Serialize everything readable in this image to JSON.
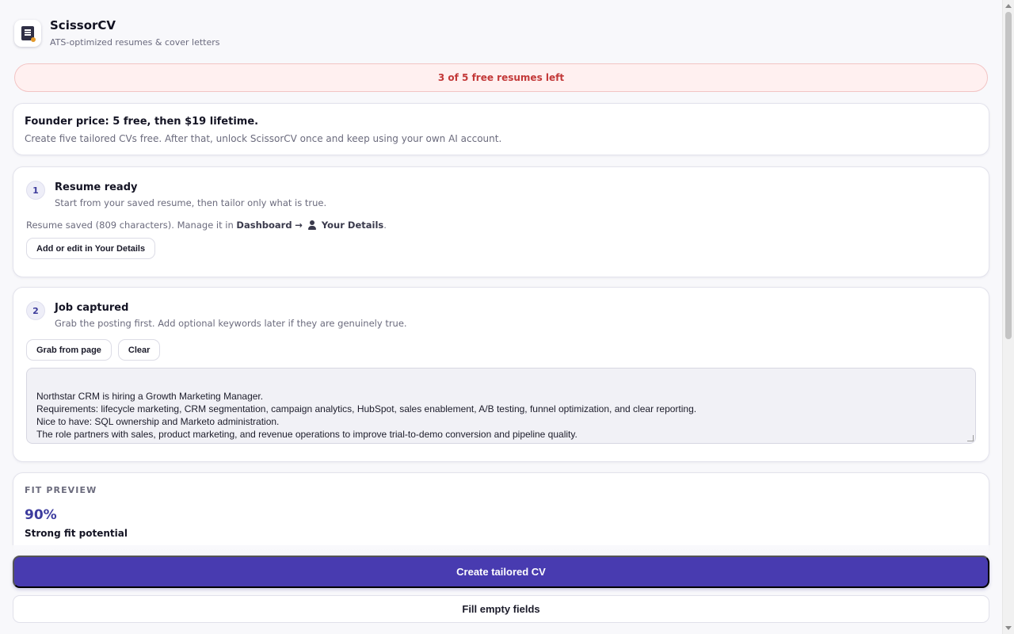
{
  "app": {
    "name": "ScissorCV",
    "tagline": "ATS-optimized resumes & cover letters",
    "logo_icon": "document-scissors-icon"
  },
  "quota": {
    "text": "3 of 5 free resumes left",
    "color": "#c33939"
  },
  "pricing": {
    "title": "Founder price: 5 free, then $19 lifetime.",
    "body": "Create five tailored CVs free. After that, unlock ScissorCV once and keep using your own AI account."
  },
  "step1": {
    "number": "1",
    "title": "Resume ready",
    "subtitle": "Start from your saved resume, then tailor only what is true.",
    "saved_prefix": "Resume saved (809 characters). Manage it in",
    "saved_dashboard": "Dashboard",
    "saved_arrow": "→",
    "saved_details": "Your Details",
    "saved_suffix": ".",
    "button": "Add or edit in Your Details"
  },
  "step2": {
    "number": "2",
    "title": "Job captured",
    "subtitle": "Grab the posting first. Add optional keywords later if they are genuinely true.",
    "grab_button": "Grab from page",
    "clear_button": "Clear",
    "job_text": "Northstar CRM is hiring a Growth Marketing Manager.\nRequirements: lifecycle marketing, CRM segmentation, campaign analytics, HubSpot, sales enablement, A/B testing, funnel optimization, and clear reporting.\nNice to have: SQL ownership and Marketo administration.\nThe role partners with sales, product marketing, and revenue operations to improve trial-to-demo conversion and pipeline quality."
  },
  "fit": {
    "label": "FIT PREVIEW",
    "score": "90%",
    "score_value": 0.9,
    "description": "Strong fit potential"
  },
  "actions": {
    "primary": "Create tailored CV",
    "secondary": "Fill empty fields"
  },
  "colors": {
    "accent": "#483bb0",
    "score": "#3d3c9e",
    "quota_bg": "#fff0f0"
  }
}
